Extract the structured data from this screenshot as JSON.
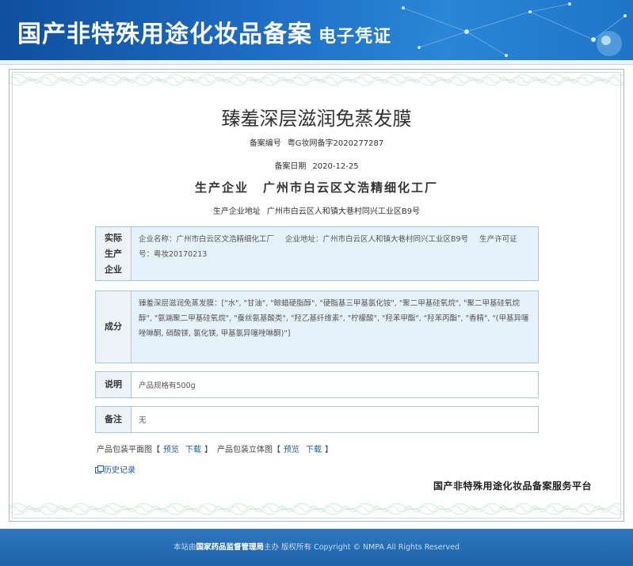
{
  "header": {
    "title": "国产非特殊用途化妆品备案",
    "subtitle": "电子凭证"
  },
  "product": {
    "name": "臻羞深层滋润免蒸发膜",
    "record_no_label": "备案编号",
    "record_no": "粤G妆网备字2020277287",
    "record_date_label": "备案日期",
    "record_date": "2020-12-25",
    "company_label": "生产企业",
    "company": "广州市白云区文浩精细化工厂",
    "address_label": "生产企业地址",
    "address": "广州市白云区人和镇大巷村同兴工业区B9号"
  },
  "sections": {
    "actual_company": {
      "head": "实际生产企业",
      "name": "企业名称：广州市白云区文浩精细化工厂",
      "address": "企业地址：广州市白云区人和镇大巷村同兴工业区B9号",
      "license": "生产许可证号：粤妆20170213"
    },
    "ingredients": {
      "head": "成分",
      "text": "臻羞深层滋润免蒸发膜：[\"水\", \"甘油\", \"鲸蜡硬脂醇\", \"硬脂基三甲基氯化铵\", \"聚二甲基硅氧烷\", \"聚二甲基硅氧烷醇\", \"氨端聚二甲基硅氧烷\", \"蚕丝氨基酸类\", \"羟乙基纤维素\", \"柠檬酸\", \"羟苯甲酯\", \"羟苯丙酯\", \"香精\", \"(甲基异噻唑啉酮, 硝酸镁, 氯化镁, 甲基氯异噻唑啉酮)\"]"
    },
    "description": {
      "head": "说明",
      "text": "产品规格有500g"
    },
    "remarks": {
      "head": "备注",
      "text": "无"
    }
  },
  "downloads": {
    "flat_label": "产品包装平面图",
    "solid_label": "产品包装立体图",
    "preview": "预览",
    "download": "下载",
    "bracket_open": "【",
    "bracket_close": "】"
  },
  "history_label": "历史记录",
  "platform": "国产非特殊用途化妆品备案服务平台",
  "footer": {
    "prefix": "本站由",
    "org": "国家药品监督管理局",
    "suffix": "主办 版权所有 Copyright © NMPA All Rights Reserved"
  },
  "colors": {
    "header_blue": "#1d6cc4",
    "table_border": "#a9c6e3",
    "table_fill": "#e6f2fb",
    "link": "#1a5ea8"
  }
}
